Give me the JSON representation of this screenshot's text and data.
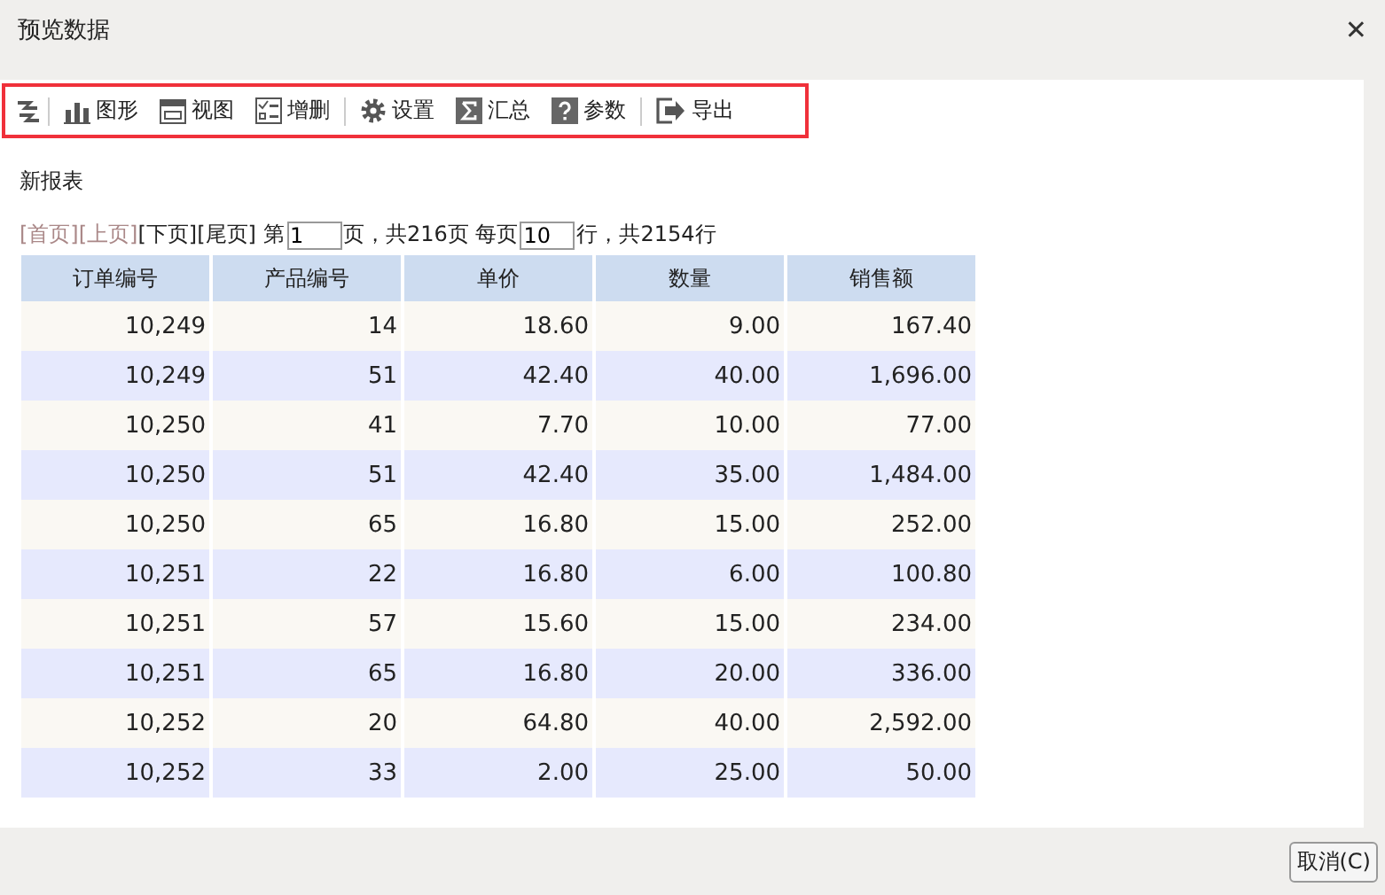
{
  "window": {
    "title": "预览数据",
    "close": "✕"
  },
  "toolbar": {
    "highlighted": true,
    "items": [
      {
        "kind": "refresh"
      },
      {
        "kind": "chart",
        "label": "图形"
      },
      {
        "kind": "view",
        "label": "视图"
      },
      {
        "kind": "edit",
        "label": "增删"
      },
      {
        "kind": "settings",
        "label": "设置"
      },
      {
        "kind": "sum",
        "label": "汇总"
      },
      {
        "kind": "param",
        "label": "参数"
      },
      {
        "kind": "export",
        "label": "导出"
      }
    ]
  },
  "report_title": "新报表",
  "pager": {
    "links": [
      {
        "label": "[首页]",
        "disabled": true
      },
      {
        "label": "[上页]",
        "disabled": true
      },
      {
        "label": "[下页]",
        "disabled": false
      },
      {
        "label": "[尾页]",
        "disabled": false
      }
    ],
    "page_prefix": "第",
    "page_value": "1",
    "page_suffix": "页，共216页 每页",
    "rows_value": "10",
    "rows_suffix": "行，共2154行"
  },
  "table": {
    "columns": [
      "订单编号",
      "产品编号",
      "单价",
      "数量",
      "销售额"
    ],
    "rows": [
      [
        "10,249",
        "14",
        "18.60",
        "9.00",
        "167.40"
      ],
      [
        "10,249",
        "51",
        "42.40",
        "40.00",
        "1,696.00"
      ],
      [
        "10,250",
        "41",
        "7.70",
        "10.00",
        "77.00"
      ],
      [
        "10,250",
        "51",
        "42.40",
        "35.00",
        "1,484.00"
      ],
      [
        "10,250",
        "65",
        "16.80",
        "15.00",
        "252.00"
      ],
      [
        "10,251",
        "22",
        "16.80",
        "6.00",
        "100.80"
      ],
      [
        "10,251",
        "57",
        "15.60",
        "15.00",
        "234.00"
      ],
      [
        "10,251",
        "65",
        "16.80",
        "20.00",
        "336.00"
      ],
      [
        "10,252",
        "20",
        "64.80",
        "40.00",
        "2,592.00"
      ],
      [
        "10,252",
        "33",
        "2.00",
        "25.00",
        "50.00"
      ]
    ]
  },
  "buttons": [
    "取消(C)"
  ]
}
